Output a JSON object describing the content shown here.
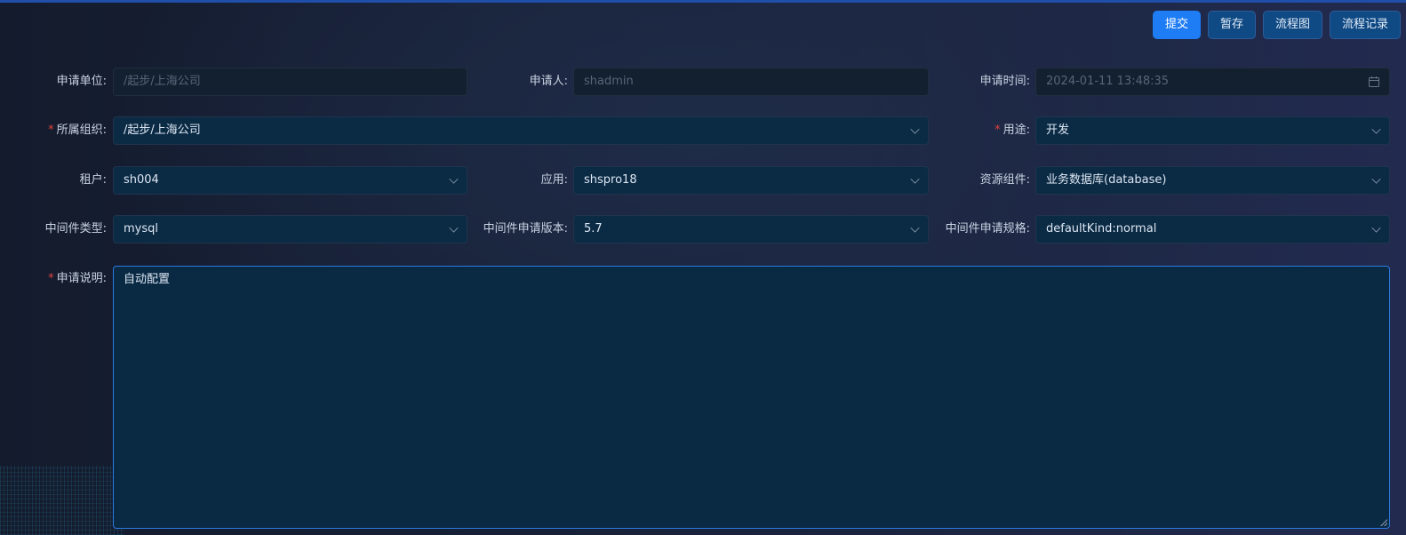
{
  "toolbar": {
    "submit": "提交",
    "save_draft": "暂存",
    "flowchart": "流程图",
    "flow_record": "流程记录"
  },
  "form": {
    "apply_unit": {
      "label": "申请单位:",
      "value": "/起步/上海公司"
    },
    "applicant": {
      "label": "申请人:",
      "value": "shadmin"
    },
    "apply_time": {
      "label": "申请时间:",
      "value": "2024-01-11 13:48:35"
    },
    "org": {
      "label": "所属组织:",
      "value": "/起步/上海公司",
      "required": true
    },
    "purpose": {
      "label": "用途:",
      "value": "开发",
      "required": true
    },
    "tenant": {
      "label": "租户:",
      "value": "sh004"
    },
    "application": {
      "label": "应用:",
      "value": "shspro18"
    },
    "resource_component": {
      "label": "资源组件:",
      "value": "业务数据库(database)"
    },
    "middleware_type": {
      "label": "中间件类型:",
      "value": "mysql"
    },
    "middleware_version": {
      "label": "中间件申请版本:",
      "value": "5.7"
    },
    "middleware_spec": {
      "label": "中间件申请规格:",
      "value": "defaultKind:normal"
    },
    "description": {
      "label": "申请说明:",
      "value": "自动配置",
      "required": true
    },
    "required_mark": "*"
  },
  "icons": {
    "dropdown": "chevron-down-icon",
    "date": "calendar-icon",
    "resize": "resize-handle-icon"
  },
  "colors": {
    "primary": "#1e7cf5",
    "button": "#104a84",
    "field_bg": "#0b2a44",
    "required": "#e0413f",
    "focus_border": "#2a7be0"
  }
}
